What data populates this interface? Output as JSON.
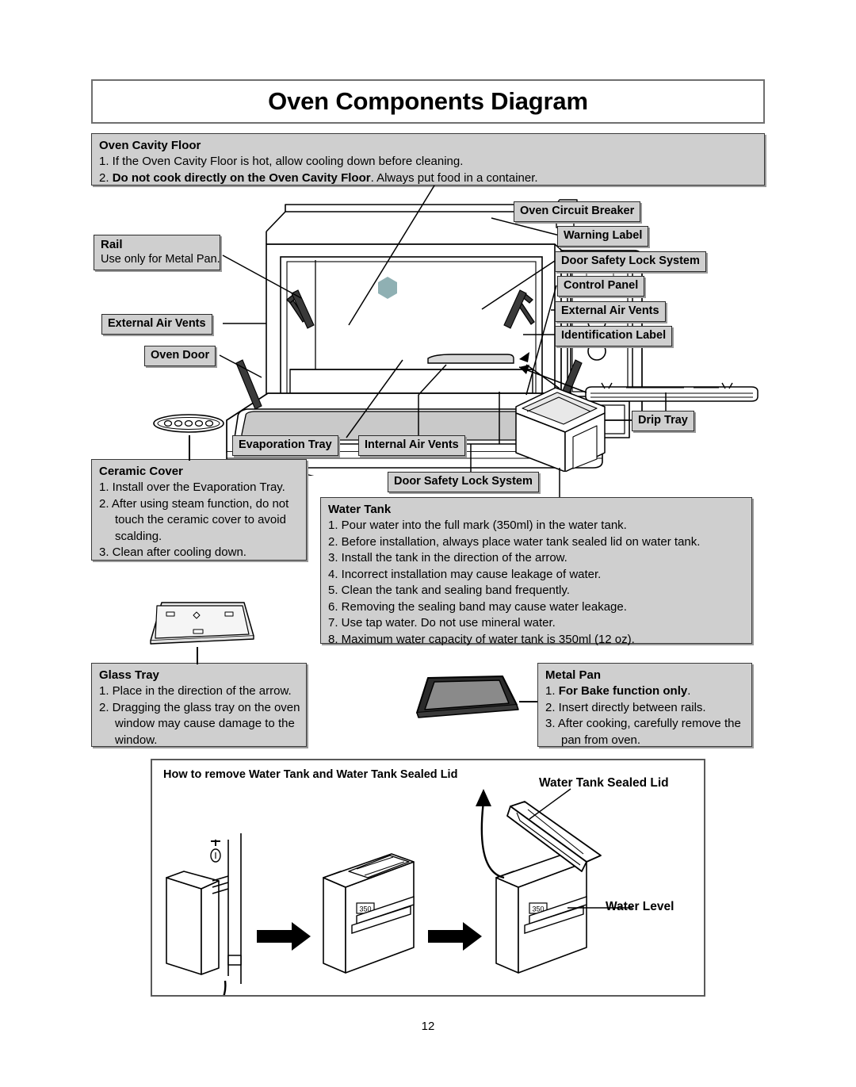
{
  "title": "Oven Components Diagram",
  "page_number": "12",
  "oven_cavity_floor": {
    "head": "Oven Cavity Floor",
    "items": [
      "1. If the Oven Cavity Floor is hot, allow cooling down before cleaning.",
      "2. Do not cook directly on the Oven Cavity Floor. Always put food in a container."
    ],
    "item2_bold": "Do not cook directly on the Oven Cavity Floor",
    "item2_rest": ". Always put food in a container."
  },
  "callouts": {
    "rail_title": "Rail",
    "rail_sub": "Use only for Metal Pan.",
    "external_air_vents_left": "External Air Vents",
    "oven_door": "Oven Door",
    "evaporation_tray": "Evaporation Tray",
    "internal_air_vents": "Internal Air Vents",
    "oven_circuit_breaker": "Oven Circuit Breaker",
    "warning_label": "Warning Label",
    "door_safety_lock_system_top": "Door Safety Lock System",
    "control_panel": "Control Panel",
    "external_air_vents_right": "External Air Vents",
    "identification_label": "Identification Label",
    "drip_tray": "Drip Tray",
    "door_safety_lock_system_bottom": "Door Safety Lock System"
  },
  "ceramic_cover": {
    "head": "Ceramic Cover",
    "items": [
      "1. Install over the Evaporation Tray.",
      "2. After using steam function, do not touch the ceramic cover to avoid scalding.",
      "3. Clean after cooling down."
    ]
  },
  "water_tank": {
    "head": "Water Tank",
    "items": [
      "1. Pour water into the full mark (350ml) in the water tank.",
      "2. Before installation, always place water tank sealed lid on water tank.",
      "3. Install the tank in the direction of the arrow.",
      "4. Incorrect installation may cause leakage of water.",
      "5. Clean the tank and sealing band frequently.",
      "6. Removing the sealing band may cause water leakage.",
      "7. Use tap water. Do not use mineral water.",
      "8. Maximum water capacity of water tank is 350ml (12 oz)."
    ]
  },
  "glass_tray": {
    "head": "Glass Tray",
    "items": [
      "1. Place in the direction of the arrow.",
      "2. Dragging the glass tray on the oven window may cause damage to the window."
    ]
  },
  "metal_pan": {
    "head": "Metal Pan",
    "item1_bold": "For Bake function only",
    "item1_rest": ".",
    "items": [
      "1. For Bake function only.",
      "2. Insert directly between rails.",
      "3. After cooking, carefully remove the pan from oven."
    ]
  },
  "bottom_panel": {
    "caption": "How to remove Water Tank and Water Tank Sealed Lid",
    "water_tank_sealed_lid": "Water Tank Sealed Lid",
    "water_level": "Water Level",
    "tank_mark": "350"
  },
  "colors": {
    "chip_fill": "#cfcfcf",
    "chip_border": "#2b2b2b",
    "shadow": "#9a9a9a",
    "tray_gray": "#c9c9c9",
    "metal_pan": "#8a8a8a",
    "hex_teal": "#8fb0b3"
  }
}
